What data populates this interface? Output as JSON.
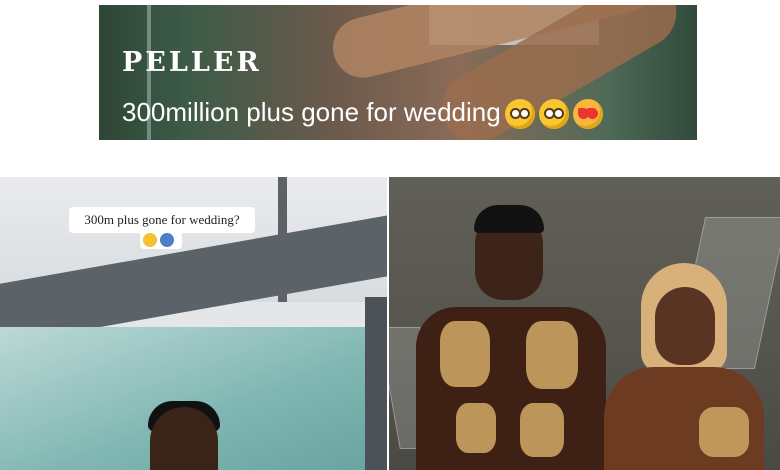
{
  "banner": {
    "brand": "PELLER",
    "headline": "300million plus gone for wedding",
    "emojis": [
      "flushed-face",
      "star-struck-face",
      "smiling-face-with-hearts"
    ]
  },
  "left_photo": {
    "caption": "300m plus gone for wedding?",
    "caption_emojis": [
      "grimacing-face",
      "person-face"
    ]
  },
  "right_photo": {
    "subjects": [
      "groom-in-brown-gold-outfit",
      "bride-in-brown-gold-outfit"
    ]
  },
  "colors": {
    "banner_bg": "#3d5b48",
    "text": "#ffffff",
    "outfit_brown": "#3e2015",
    "outfit_gold": "#c9a262"
  }
}
